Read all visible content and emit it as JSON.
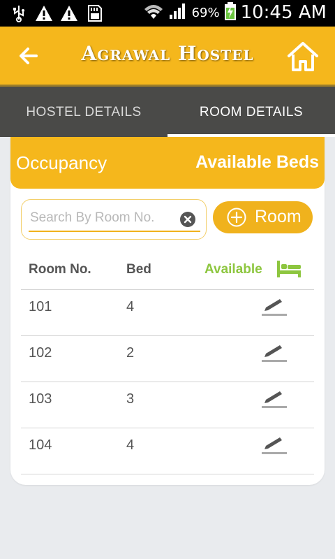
{
  "status_bar": {
    "left_icons": [
      "usb-icon",
      "warning-icon",
      "warning-icon",
      "sd-card-icon"
    ],
    "wifi": "wifi-icon",
    "signal": "signal-icon",
    "battery_pct": "69%",
    "battery": "battery-charging-icon",
    "time": "10:45 AM"
  },
  "app_bar": {
    "title": "Agrawal Hostel",
    "back_icon": "arrow-back-icon",
    "home_icon": "home-icon"
  },
  "tabs": {
    "items": [
      {
        "label": "HOSTEL DETAILS",
        "selected": false
      },
      {
        "label": "ROOM DETAILS",
        "selected": true
      }
    ]
  },
  "card": {
    "occupancy_label": "Occupancy",
    "available_beds_label": "Available Beds",
    "search": {
      "placeholder": "Search By Room No.",
      "value": ""
    },
    "add_room_label": "Room",
    "columns": {
      "room": "Room No.",
      "bed": "Bed",
      "available": "Available"
    },
    "rows": [
      {
        "room": "101",
        "bed": "4"
      },
      {
        "room": "102",
        "bed": "2"
      },
      {
        "room": "103",
        "bed": "3"
      },
      {
        "room": "104",
        "bed": "4"
      }
    ]
  },
  "colors": {
    "accent": "#f5b71c",
    "tab_bar": "#4a4a48",
    "available_green": "#8dc63f",
    "background": "#e9ebee"
  }
}
